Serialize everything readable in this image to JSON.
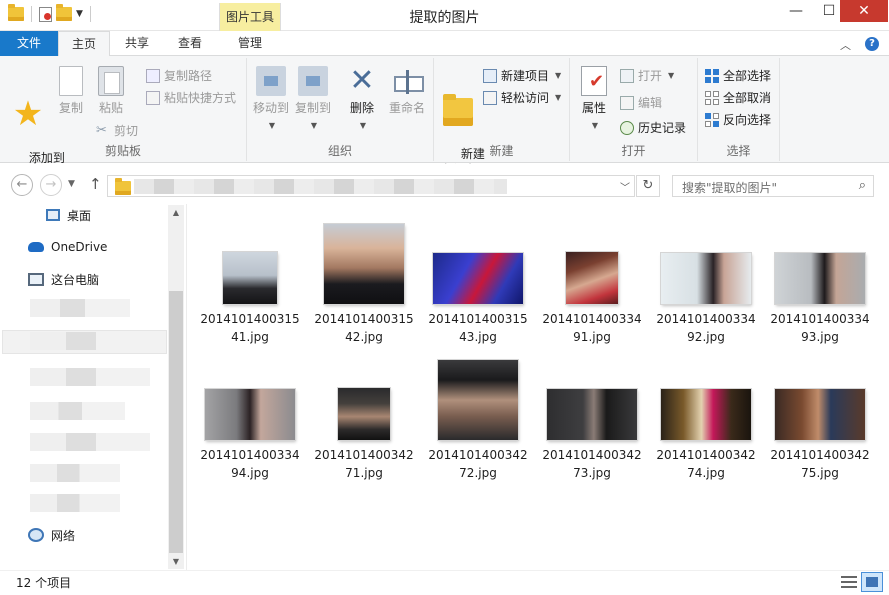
{
  "window": {
    "title": "提取的图片",
    "contextual_tab_header": "图片工具",
    "controls": {
      "minimize": "—",
      "maximize": "☐",
      "close": "✕"
    }
  },
  "tabs": {
    "file": "文件",
    "home": "主页",
    "share": "共享",
    "view": "查看",
    "manage": "管理"
  },
  "ribbon": {
    "clipboard": {
      "label": "剪贴板",
      "pin": "添加到\n收藏夹",
      "copy": "复制",
      "paste": "粘贴",
      "copy_path": "复制路径",
      "paste_shortcut": "粘贴快捷方式",
      "cut": "剪切"
    },
    "organize": {
      "label": "组织",
      "move_to": "移动到",
      "copy_to": "复制到",
      "delete": "删除",
      "rename": "重命名"
    },
    "new": {
      "label": "新建",
      "new_folder": "新建\n文件夹",
      "new_item": "新建项目",
      "easy_access": "轻松访问"
    },
    "open": {
      "label": "打开",
      "properties": "属性",
      "open": "打开",
      "edit": "编辑",
      "history": "历史记录"
    },
    "select": {
      "label": "选择",
      "select_all": "全部选择",
      "select_none": "全部取消",
      "invert": "反向选择"
    }
  },
  "address": {
    "search_placeholder": "搜索\"提取的图片\""
  },
  "navpane": {
    "desktop": "桌面",
    "onedrive": "OneDrive",
    "this_pc": "这台电脑",
    "network": "网络"
  },
  "files": [
    {
      "name": "2014101400315 41.jpg",
      "w": 54,
      "h": 52,
      "bg": "linear-gradient(180deg,#cfd6de 0%,#b7c0ca 45%,#2a2a2e 70%,#141416 100%)"
    },
    {
      "name": "2014101400315 42.jpg",
      "w": 80,
      "h": 80,
      "bg": "linear-gradient(180deg,#c5ccd4 0%,#d9b49a 30%,#a37861 55%,#1b1b1f 75%,#0f0f12 100%)"
    },
    {
      "name": "2014101400315 43.jpg",
      "w": 90,
      "h": 51,
      "bg": "linear-gradient(120deg,#1d2a8a 0%,#3a3fd0 35%,#c8173a 55%,#2f3ab8 75%,#10166a 100%)"
    },
    {
      "name": "2014101400334 91.jpg",
      "w": 52,
      "h": 52,
      "bg": "linear-gradient(160deg,#3a2020 0%,#7a4030 30%,#d6a890 55%,#c2343c 80%,#5a1c1e 100%)"
    },
    {
      "name": "2014101400334 92.jpg",
      "w": 90,
      "h": 51,
      "bg": "linear-gradient(90deg,#e8eef1 0%,#d8e0e4 40%,#2a2326 58%,#c8a496 70%,#e6ebee 100%)"
    },
    {
      "name": "2014101400334 93.jpg",
      "w": 90,
      "h": 51,
      "bg": "linear-gradient(90deg,#cfd3d6 0%,#b8bcc0 40%,#1e1a1c 55%,#c4a596 68%,#a9acaf 100%)"
    },
    {
      "name": "2014101400334 94.jpg",
      "w": 90,
      "h": 51,
      "bg": "linear-gradient(90deg,#a3a3a5 0%,#7b7b7e 35%,#2b2224 50%,#c3a79c 62%,#8b8b8f 100%)"
    },
    {
      "name": "2014101400342 71.jpg",
      "w": 52,
      "h": 52,
      "bg": "linear-gradient(180deg,#2a2a2c 0%,#44403c 30%,#a88672 55%,#2c2a2a 80%,#111 100%)"
    },
    {
      "name": "2014101400342 72.jpg",
      "w": 80,
      "h": 80,
      "bg": "linear-gradient(180deg,#3a3a3c 0%,#1a1a1c 25%,#b0907c 50%,#7a5e50 70%,#2a2a2c 100%)"
    },
    {
      "name": "2014101400342 73.jpg",
      "w": 90,
      "h": 51,
      "bg": "linear-gradient(90deg,#2e2e30 0%,#3e3e40 40%,#8a7c76 52%,#1a1a1a 66%,#3a3a3c 100%)"
    },
    {
      "name": "2014101400342 74.jpg",
      "w": 90,
      "h": 51,
      "bg": "linear-gradient(90deg,#2a2218 0%,#7a5a2a 25%,#e3d2b0 45%,#c4185a 58%,#3a2a1a 78%,#1a140e 100%)"
    },
    {
      "name": "2014101400342 75.jpg",
      "w": 90,
      "h": 51,
      "bg": "linear-gradient(90deg,#3a2a24 0%,#7a4a30 30%,#c08c6a 48%,#2a3a5a 62%,#5a3a2a 100%)"
    }
  ],
  "status": {
    "item_count": "12 个项目"
  }
}
